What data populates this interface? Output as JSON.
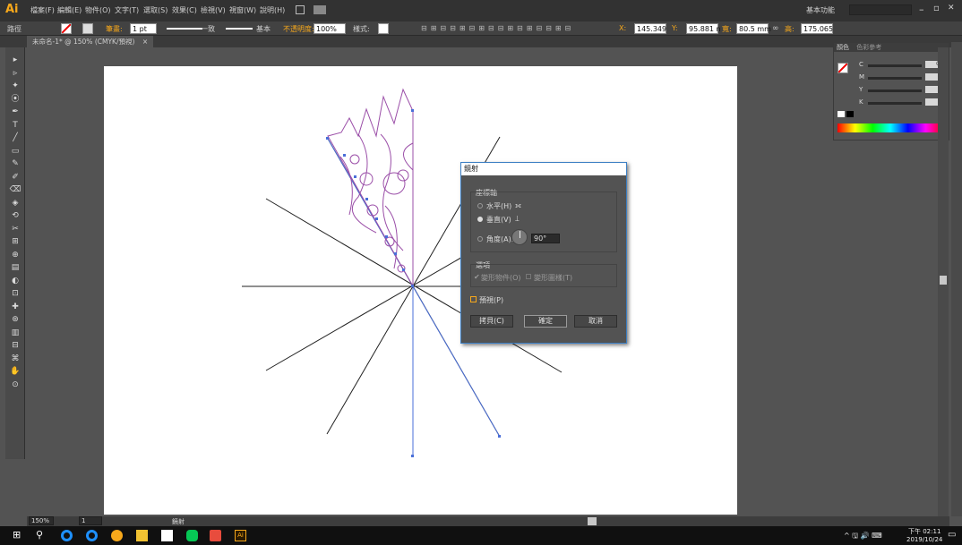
{
  "app": {
    "logo": "Ai"
  },
  "menubar": {
    "items": [
      "檔案(F)",
      "編輯(E)",
      "物件(O)",
      "文字(T)",
      "選取(S)",
      "效果(C)",
      "檢視(V)",
      "視窗(W)",
      "說明(H)"
    ],
    "workspace": "基本功能",
    "window_controls": {
      "minimize": "–",
      "restore": "▫",
      "close": "✕"
    }
  },
  "controlbar": {
    "selection_label": "路徑",
    "stroke_label": "筆畫:",
    "stroke_weight": "1 pt",
    "stroke_style_uniform": "一致",
    "stroke_profile": "基本",
    "opacity_label": "不透明度:",
    "opacity_value": "100%",
    "style_label": "樣式:",
    "x_label": "X:",
    "x_value": "145.349",
    "y_label": "Y:",
    "y_value": "95.881 n",
    "w_label": "寬:",
    "w_value": "80.5 mm",
    "h_label": "高:",
    "h_value": "175.065"
  },
  "document": {
    "tab_title": "未命名-1* @ 150% (CMYK/預視)",
    "tab_close": "×"
  },
  "tools": [
    "▸",
    "▹",
    "✦",
    "⦿",
    "✒",
    "T",
    "╱",
    "▭",
    "✎",
    "✐",
    "⌫",
    "◈",
    "⟲",
    "✂",
    "⊞",
    "⊕",
    "▤",
    "◐",
    "⊡",
    "✚",
    "⊛",
    "▥",
    "⊟",
    "⌘",
    "✋",
    "⊙"
  ],
  "dialog": {
    "title": "鏡射",
    "axis_group": "座標軸",
    "horizontal": "水平(H)",
    "vertical": "垂直(V)",
    "angle_label": "角度(A):",
    "angle_value": "90°",
    "options_group": "選項",
    "transform_objects": "變形物件(O)",
    "transform_patterns": "變形圖樣(T)",
    "preview": "預視(P)",
    "copy_button": "拷貝(C)",
    "ok_button": "確定",
    "cancel_button": "取消"
  },
  "color_panel": {
    "tab_color": "顏色",
    "tab_guide": "色彩參考",
    "channels": [
      {
        "label": "C",
        "value": "0",
        "unit": "%"
      },
      {
        "label": "M",
        "value": "",
        "unit": "%"
      },
      {
        "label": "Y",
        "value": "",
        "unit": "%"
      },
      {
        "label": "K",
        "value": "",
        "unit": "%"
      }
    ]
  },
  "statusbar": {
    "zoom": "150%",
    "page": "1",
    "tool_name": "鏡射"
  },
  "taskbar": {
    "time": "下午 02:11",
    "date": "2019/10/24",
    "tray": "^ 🖫 🔊 ⌨"
  },
  "colors": {
    "accent_ai": "#f7a81b",
    "selection_blue": "#4a6fd8",
    "artwork_purple": "#9b4fa8",
    "dialog_border": "#3c7fc4"
  }
}
